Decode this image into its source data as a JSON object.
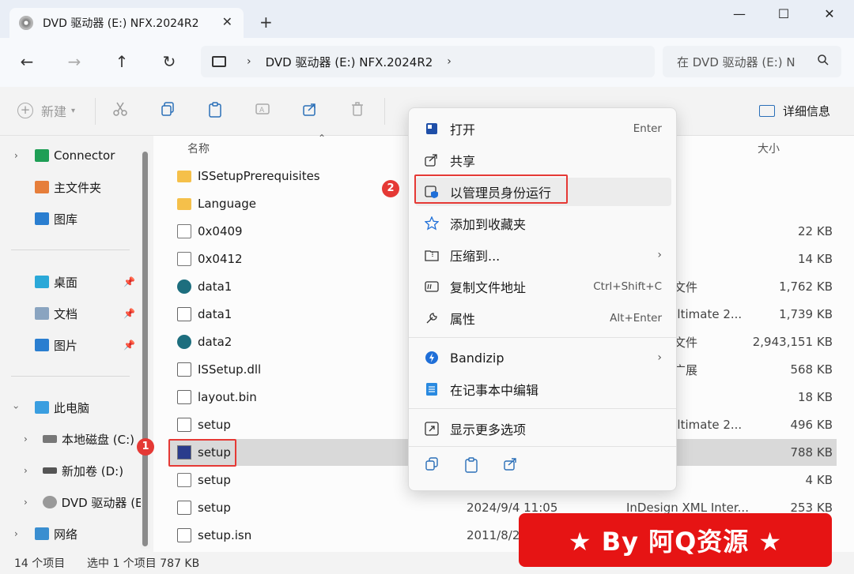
{
  "window": {
    "tab_title": "DVD 驱动器 (E:) NFX.2024R2",
    "tab_close": "✕",
    "new_tab": "+",
    "minimize": "—",
    "maximize": "☐",
    "close": "✕"
  },
  "nav": {
    "back": "←",
    "forward": "→",
    "up": "↑",
    "refresh": "↻",
    "path": "DVD 驱动器 (E:) NFX.2024R2",
    "search_placeholder": "在 DVD 驱动器 (E:) N"
  },
  "toolbar": {
    "new_label": "新建",
    "details_label": "详细信息"
  },
  "sidebar": {
    "items": [
      {
        "label": "Connector"
      },
      {
        "label": "主文件夹"
      },
      {
        "label": "图库"
      },
      {
        "label": "桌面"
      },
      {
        "label": "文档"
      },
      {
        "label": "图片"
      },
      {
        "label": "此电脑"
      },
      {
        "label": "本地磁盘 (C:)"
      },
      {
        "label": "新加卷 (D:)"
      },
      {
        "label": "DVD 驱动器 (E"
      },
      {
        "label": "网络"
      }
    ]
  },
  "filelist": {
    "col_name": "名称",
    "col_size": "大小",
    "rows": [
      {
        "name": "ISSetupPrerequisites",
        "type": "",
        "size": "",
        "date": ""
      },
      {
        "name": "Language",
        "type": "",
        "size": "",
        "date": ""
      },
      {
        "name": "0x0409",
        "type": "",
        "size": "22 KB",
        "date": ""
      },
      {
        "name": "0x0412",
        "type": "",
        "size": "14 KB",
        "date": ""
      },
      {
        "name": "data1",
        "type": "文件",
        "size": "1,762 KB",
        "date": ""
      },
      {
        "name": "data1",
        "type": "Jltimate 2...",
        "size": "1,739 KB",
        "date": ""
      },
      {
        "name": "data2",
        "type": "文件",
        "size": "2,943,151 KB",
        "date": ""
      },
      {
        "name": "ISSetup.dll",
        "type": "广展",
        "size": "568 KB",
        "date": ""
      },
      {
        "name": "layout.bin",
        "type": "",
        "size": "18 KB",
        "date": ""
      },
      {
        "name": "setup",
        "type": "Jltimate 2...",
        "size": "496 KB",
        "date": ""
      },
      {
        "name": "setup",
        "type": "",
        "size": "788 KB",
        "date": ""
      },
      {
        "name": "setup",
        "type": "",
        "size": "4 KB",
        "date": ""
      },
      {
        "name": "setup",
        "type": "InDesign XML Inter...",
        "size": "253 KB",
        "date": "2024/9/4 11:05"
      },
      {
        "name": "setup.isn",
        "type": "",
        "size": "",
        "date": "2011/8/2"
      }
    ]
  },
  "status": {
    "count": "14 个项目",
    "selected": "选中 1 个项目  787 KB"
  },
  "context_menu": {
    "items": [
      {
        "label": "打开",
        "shortcut": "Enter"
      },
      {
        "label": "共享",
        "shortcut": ""
      },
      {
        "label": "以管理员身份运行",
        "shortcut": ""
      },
      {
        "label": "添加到收藏夹",
        "shortcut": ""
      },
      {
        "label": "压缩到...",
        "shortcut": ""
      },
      {
        "label": "复制文件地址",
        "shortcut": "Ctrl+Shift+C"
      },
      {
        "label": "属性",
        "shortcut": "Alt+Enter"
      },
      {
        "label": "Bandizip",
        "shortcut": ""
      },
      {
        "label": "在记事本中编辑",
        "shortcut": ""
      },
      {
        "label": "显示更多选项",
        "shortcut": ""
      }
    ],
    "submenu_arrow": "›"
  },
  "annotations": {
    "badge1": "1",
    "badge2": "2"
  },
  "banner": {
    "text": "★ By 阿Q资源 ★"
  },
  "colors": {
    "accent": "#2a6fb8",
    "highlight": "#e53935",
    "banner": "#e61414"
  }
}
